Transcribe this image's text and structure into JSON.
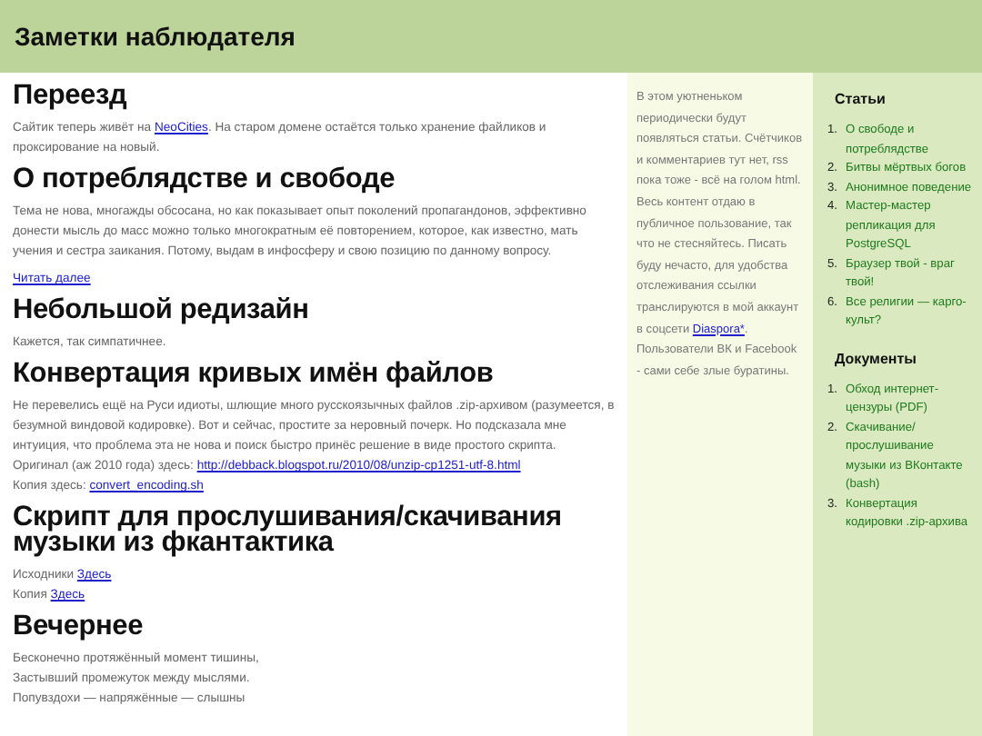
{
  "header": {
    "title": "Заметки наблюдателя"
  },
  "posts": [
    {
      "title": "Переезд",
      "paragraphs": [
        {
          "parts": [
            {
              "text": "Сайтик теперь живёт на "
            },
            {
              "link": "NeoCities"
            },
            {
              "text": ". На старом домене остаётся только хранение файликов и проксирование на новый."
            }
          ]
        }
      ]
    },
    {
      "title": "О потреблядстве и свободе",
      "paragraphs": [
        {
          "parts": [
            {
              "text": "Тема не нова, многажды обсосана, но как показывает опыт поколений пропагандонов, эффективно донести мысль до масс можно только многократным её повторением, которое, как известно, мать учения и сестра заикания. Потому, выдам в инфосферу и свою позицию по данному вопросу."
            }
          ]
        }
      ],
      "more": "Читать далее"
    },
    {
      "title": "Небольшой редизайн",
      "paragraphs": [
        {
          "parts": [
            {
              "text": "Кажется, так симпатичнее."
            }
          ]
        }
      ]
    },
    {
      "title": "Конвертация кривых имён файлов",
      "paragraphs": [
        {
          "parts": [
            {
              "text": "Не перевелись ещё на Руси идиоты, шлющие много русскоязычных файлов .zip-архивом (разумеется, в безумной виндовой кодировке). Вот и сейчас, простите за неровный почерк. Но подсказала мне интуиция, что проблема эта не нова и поиск быстро принёс решение в виде простого скрипта."
            }
          ]
        },
        {
          "parts": [
            {
              "text": "Оригинал (аж 2010 года) здесь: "
            },
            {
              "link": "http://debback.blogspot.ru/2010/08/unzip-cp1251-utf-8.html"
            }
          ]
        },
        {
          "parts": [
            {
              "text": "Копия здесь: "
            },
            {
              "link": "convert_encoding.sh"
            }
          ]
        }
      ]
    },
    {
      "title": "Скрипт для прослушивания/скачивания музыки из фкантактика",
      "paragraphs": [
        {
          "parts": [
            {
              "text": "Исходники "
            },
            {
              "link": "Здесь"
            }
          ]
        },
        {
          "parts": [
            {
              "text": "Копия "
            },
            {
              "link": "Здесь"
            }
          ]
        }
      ]
    },
    {
      "title": "Вечернее",
      "paragraphs": [
        {
          "parts": [
            {
              "text": "Бесконечно протяжённый момент тишины,"
            }
          ]
        },
        {
          "parts": [
            {
              "text": "Застывший промежуток между мыслями."
            }
          ]
        },
        {
          "parts": [
            {
              "text": "Попувздохи — напряжённые — слышны"
            }
          ]
        }
      ]
    }
  ],
  "about": {
    "parts": [
      {
        "text": "В этом уютненьком периодически будут появляться статьи. Счётчиков и комментариев тут нет, rss пока тоже - всё на голом html. Весь контент отдаю в публичное пользование, так что не стесняйтесь. Писать буду нечасто, для удобства отслеживания ссылки транслируются в мой аккаунт в соцсети "
      },
      {
        "link": "Diaspora*"
      },
      {
        "text": ". Пользователи ВК и Facebook - сами себе злые буратины."
      }
    ]
  },
  "sections": [
    {
      "title": "Статьи",
      "items": [
        {
          "number": "1.",
          "label": "О свободе и потреблядстве"
        },
        {
          "number": "2.",
          "label": "Битвы мёртвых богов"
        },
        {
          "number": "3.",
          "label": "Анонимное поведение"
        },
        {
          "number": "4.",
          "label": "Мастер-мастер репликация для PostgreSQL"
        },
        {
          "number": "5.",
          "label": "Браузер твой - враг твой!"
        },
        {
          "number": "6.",
          "label": "Все религии — карго-культ?"
        }
      ]
    },
    {
      "title": "Документы",
      "items": [
        {
          "number": "1.",
          "label": "Обход интернет-цензуры (PDF)"
        },
        {
          "number": "2.",
          "label": "Скачивание/прослушивание музыки из ВКонтакте (bash)"
        },
        {
          "number": "3.",
          "label": "Конвертация кодировки .zip-архива"
        }
      ]
    }
  ]
}
